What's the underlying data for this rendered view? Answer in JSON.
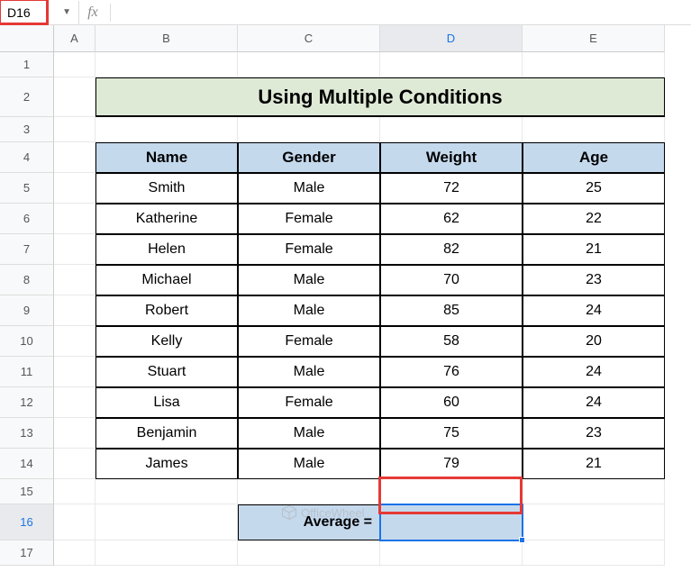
{
  "nameBox": "D16",
  "fxSymbol": "fx",
  "formula": "",
  "columns": [
    "A",
    "B",
    "C",
    "D",
    "E"
  ],
  "rows": [
    "1",
    "2",
    "3",
    "4",
    "5",
    "6",
    "7",
    "8",
    "9",
    "10",
    "11",
    "12",
    "13",
    "14",
    "15",
    "16",
    "17"
  ],
  "selectedColumn": "D",
  "selectedRow": "16",
  "title": "Using Multiple Conditions",
  "headers": {
    "name": "Name",
    "gender": "Gender",
    "weight": "Weight",
    "age": "Age"
  },
  "tableData": [
    {
      "name": "Smith",
      "gender": "Male",
      "weight": "72",
      "age": "25"
    },
    {
      "name": "Katherine",
      "gender": "Female",
      "weight": "62",
      "age": "22"
    },
    {
      "name": "Helen",
      "gender": "Female",
      "weight": "82",
      "age": "21"
    },
    {
      "name": "Michael",
      "gender": "Male",
      "weight": "70",
      "age": "23"
    },
    {
      "name": "Robert",
      "gender": "Male",
      "weight": "85",
      "age": "24"
    },
    {
      "name": "Kelly",
      "gender": "Female",
      "weight": "58",
      "age": "20"
    },
    {
      "name": "Stuart",
      "gender": "Male",
      "weight": "76",
      "age": "24"
    },
    {
      "name": "Lisa",
      "gender": "Female",
      "weight": "60",
      "age": "24"
    },
    {
      "name": "Benjamin",
      "gender": "Male",
      "weight": "75",
      "age": "23"
    },
    {
      "name": "James",
      "gender": "Male",
      "weight": "79",
      "age": "21"
    }
  ],
  "averageLabel": "Average =",
  "averageValue": "",
  "watermark": "OfficeWheel"
}
